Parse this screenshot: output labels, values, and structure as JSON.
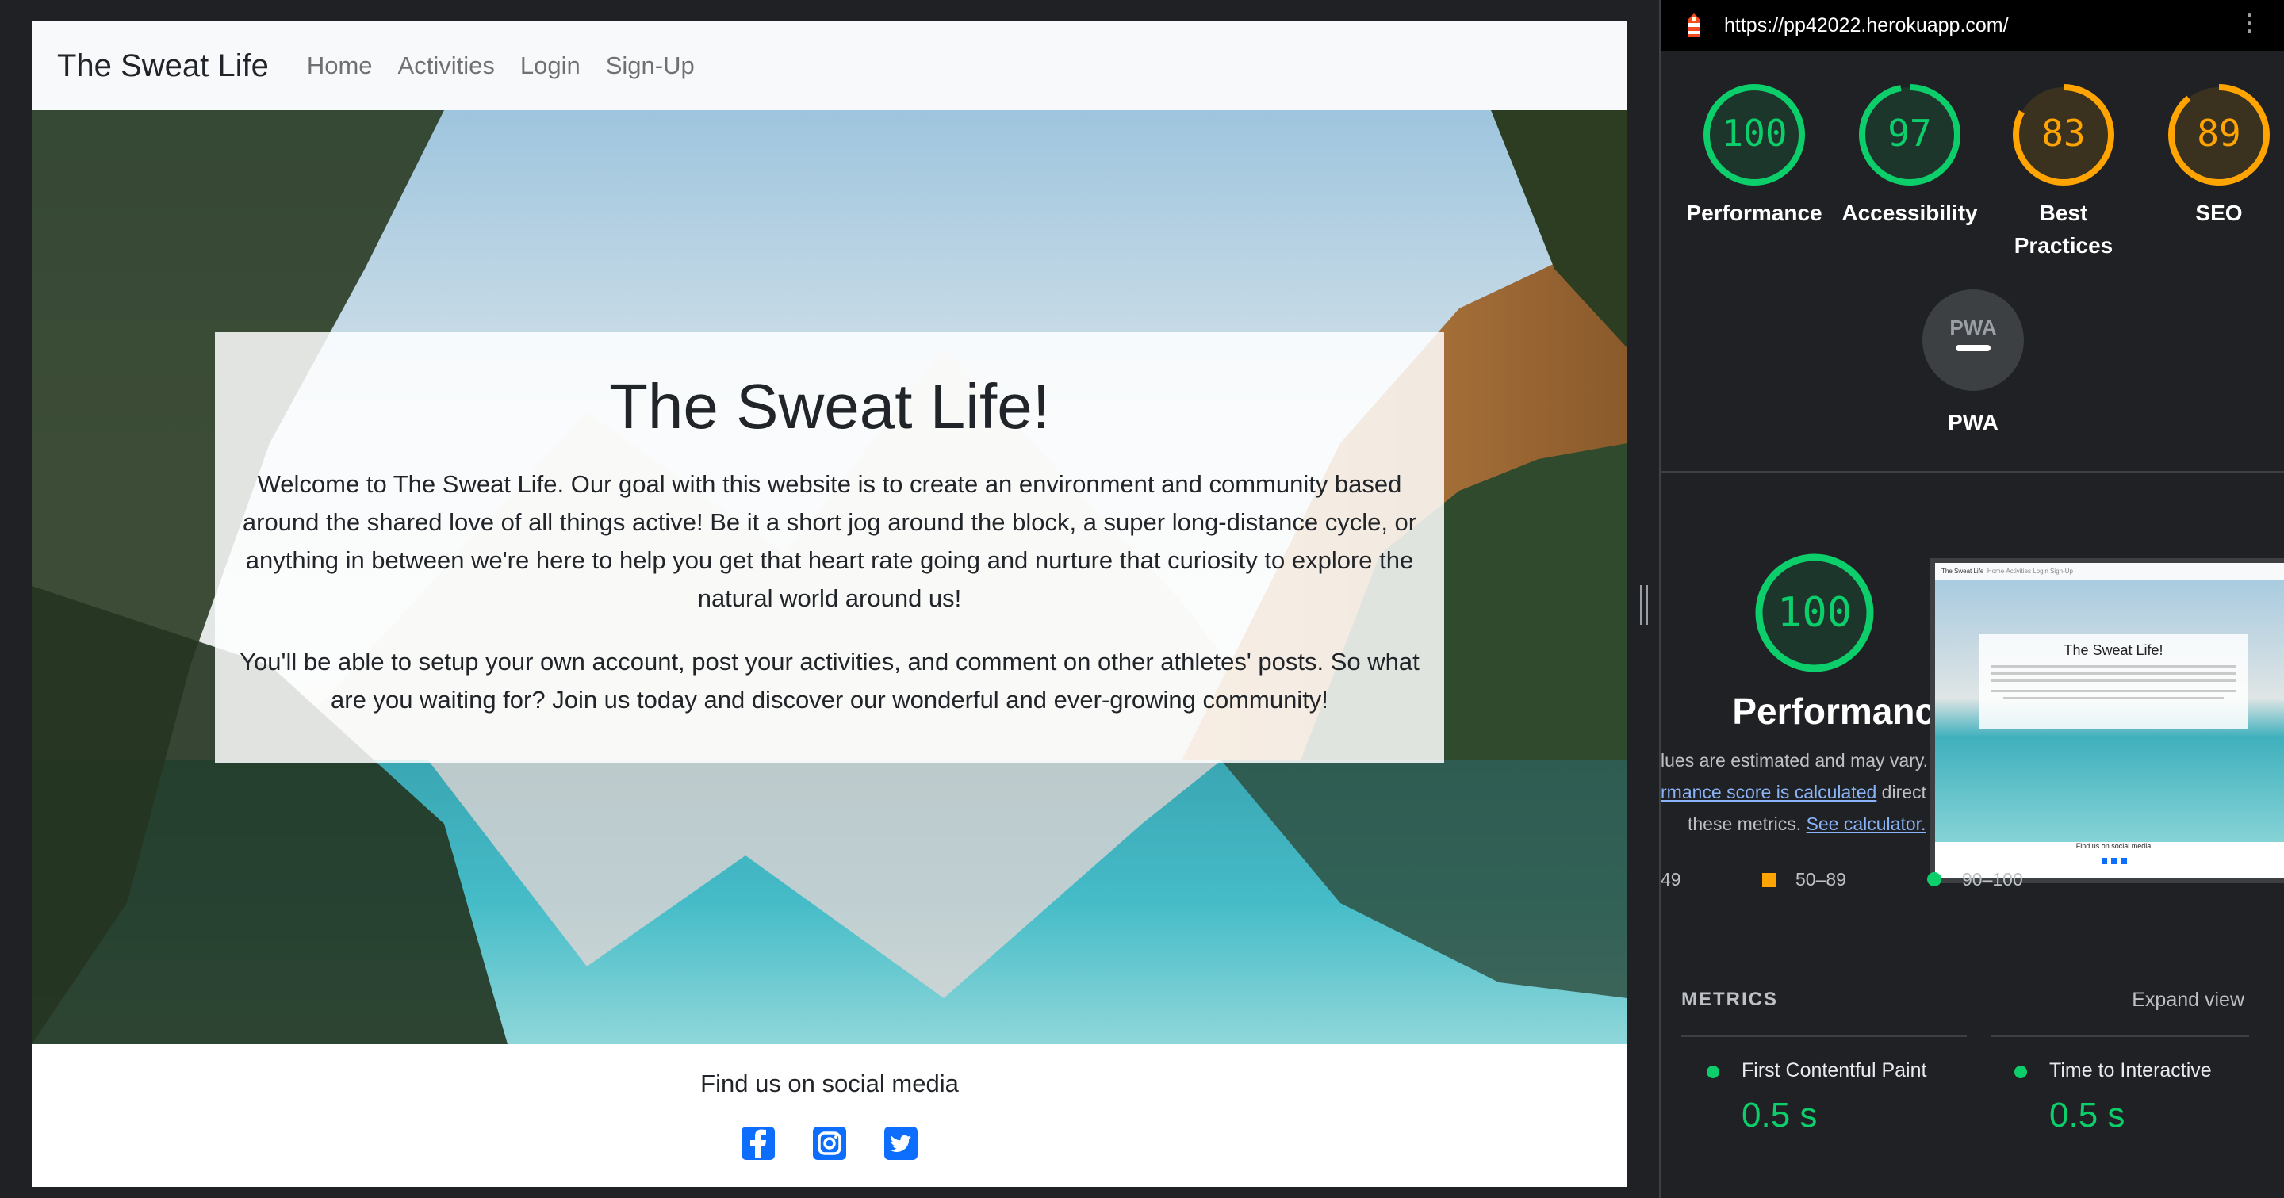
{
  "site": {
    "brand": "The Sweat Life",
    "nav": [
      "Home",
      "Activities",
      "Login",
      "Sign-Up"
    ],
    "hero": {
      "title": "The Sweat Life!",
      "p1": "Welcome to The Sweat Life. Our goal with this website is to create an environment and community based around the shared love of all things active! Be it a short jog around the block, a super long-distance cycle, or anything in between we're here to help you get that heart rate going and nurture that curiosity to explore the natural world around us!",
      "p2": "You'll be able to setup your own account, post your activities, and comment on other athletes' posts. So what are you waiting for? Join us today and discover our wonderful and ever-growing community!"
    },
    "footer": {
      "text": "Find us on social media",
      "icons": [
        "facebook-icon",
        "instagram-icon",
        "twitter-icon"
      ]
    },
    "accent_color": "#0d6efd"
  },
  "lighthouse": {
    "url": "https://pp42022.herokuapp.com/",
    "scores": [
      {
        "label": "Performance",
        "value": 100,
        "color": "#0cce6b"
      },
      {
        "label": "Accessibility",
        "value": 97,
        "color": "#0cce6b"
      },
      {
        "label": "Best Practices",
        "value": 83,
        "color": "#ffa400"
      },
      {
        "label": "SEO",
        "value": 89,
        "color": "#ffa400"
      }
    ],
    "pwa": {
      "badge": "PWA",
      "label": "PWA"
    },
    "performance": {
      "score": "100",
      "label": "Performance",
      "note1": "lues are estimated and may vary.",
      "note2_link": "rmance score is calculated",
      "note2_rest": " direct",
      "note3_text": "these metrics.",
      "note3_link": "See calculator.",
      "thumb_title": "The Sweat Life!",
      "thumb_footer": "Find us on social media"
    },
    "legend": {
      "low": "49",
      "mid": "50–89",
      "high": "90–100"
    },
    "metrics": {
      "heading": "METRICS",
      "expand": "Expand view",
      "items": [
        {
          "name": "First Contentful Paint",
          "value": "0.5 s"
        },
        {
          "name": "Time to Interactive",
          "value": "0.5 s"
        }
      ]
    }
  }
}
